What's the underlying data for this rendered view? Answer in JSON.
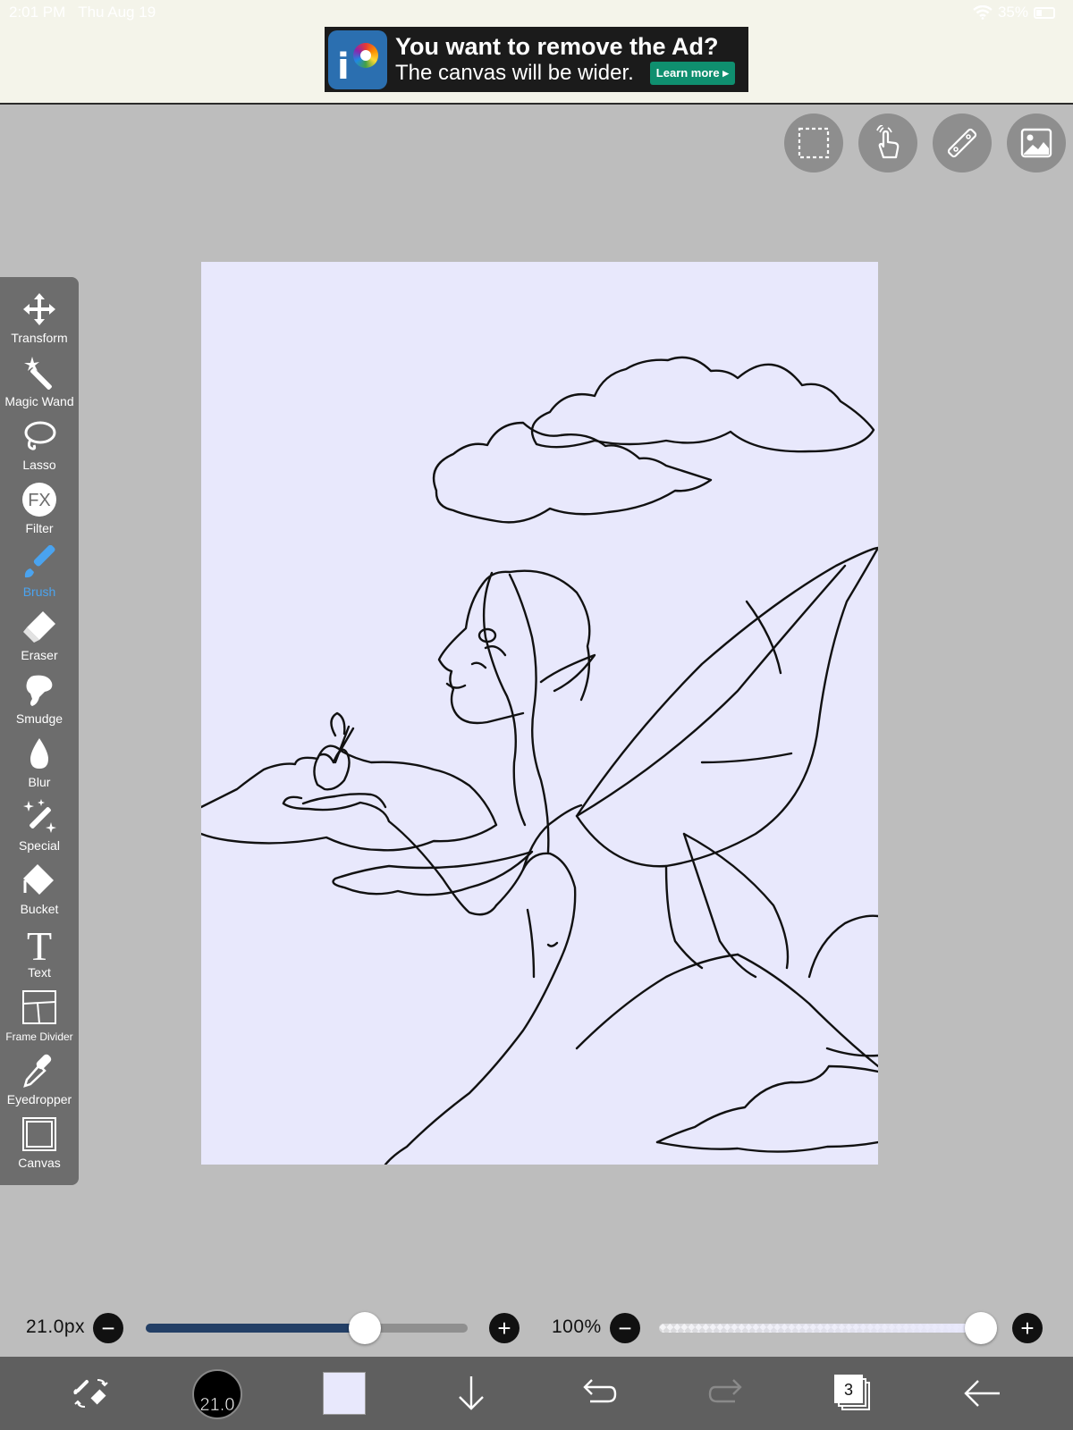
{
  "status_bar": {
    "time": "2:01 PM",
    "date": "Thu Aug 19",
    "battery": "35%"
  },
  "ad": {
    "title": "You want to remove the Ad?",
    "subtitle": "The canvas will be wider.",
    "button": "Learn more ▸"
  },
  "top_tools": [
    "selection-icon",
    "hand-gesture-icon",
    "ruler-icon",
    "image-icon"
  ],
  "tools": [
    {
      "label": "Transform",
      "icon": "transform-icon"
    },
    {
      "label": "Magic Wand",
      "icon": "magic-wand-icon"
    },
    {
      "label": "Lasso",
      "icon": "lasso-icon"
    },
    {
      "label": "Filter",
      "icon": "fx-icon"
    },
    {
      "label": "Brush",
      "icon": "brush-icon",
      "active": true
    },
    {
      "label": "Eraser",
      "icon": "eraser-icon"
    },
    {
      "label": "Smudge",
      "icon": "smudge-icon"
    },
    {
      "label": "Blur",
      "icon": "blur-icon"
    },
    {
      "label": "Special",
      "icon": "special-icon"
    },
    {
      "label": "Bucket",
      "icon": "bucket-icon"
    },
    {
      "label": "Text",
      "icon": "text-icon"
    },
    {
      "label": "Frame Divider",
      "icon": "frame-divider-icon"
    },
    {
      "label": "Eyedropper",
      "icon": "eyedropper-icon"
    },
    {
      "label": "Canvas",
      "icon": "canvas-icon"
    }
  ],
  "brush_size": {
    "label": "21.0px",
    "fraction": 0.68,
    "minus": "−",
    "plus": "+"
  },
  "opacity": {
    "label": "100%",
    "fraction": 1.0,
    "minus": "−",
    "plus": "+"
  },
  "bottom_bar": {
    "brush_size_badge": "21.0",
    "layer_count": "3",
    "current_color": "#e8e8fc"
  },
  "colors": {
    "canvas_bg": "#e8e8fc",
    "active_tool": "#4aa3ef",
    "panel": "#6d6d6d",
    "workspace": "#bdbdbd"
  }
}
